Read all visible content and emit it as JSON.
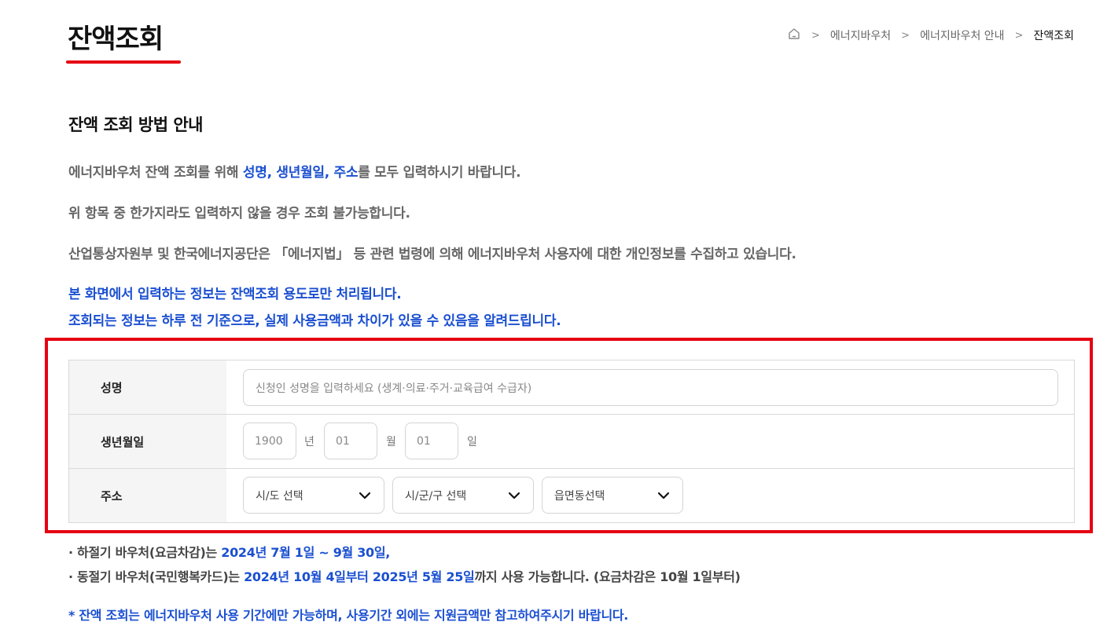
{
  "header": {
    "title": "잔액조회",
    "breadcrumb": [
      "에너지바우처",
      "에너지바우처 안내",
      "잔액조회"
    ]
  },
  "guide": {
    "heading": "잔액 조회 방법 안내",
    "line1_pre": "에너지바우처 잔액 조회를 위해 ",
    "line1_highlight": "성명, 생년월일, 주소",
    "line1_post": "를 모두 입력하시기 바랍니다.",
    "line2": "위 항목 중 한가지라도 입력하지 않을 경우 조회 불가능합니다.",
    "line3": "산업통상자원부 및 한국에너지공단은 「에너지법」 등 관련 법령에 의해 에너지바우처 사용자에 대한 개인정보를 수집하고 있습니다.",
    "notice1": "본 화면에서 입력하는 정보는 잔액조회 용도로만 처리됩니다.",
    "notice2": "조회되는 정보는 하루 전 기준으로, 실제 사용금액과 차이가 있을 수 있음을 알려드립니다."
  },
  "form": {
    "name_label": "성명",
    "name_placeholder": "신청인 성명을 입력하세요 (생계·의료·주거·교육급여 수급자)",
    "birth_label": "생년월일",
    "birth_year_placeholder": "1900",
    "birth_year_unit": "년",
    "birth_month_placeholder": "01",
    "birth_month_unit": "월",
    "birth_day_placeholder": "01",
    "birth_day_unit": "일",
    "address_label": "주소",
    "sido_select": "시/도 선택",
    "sigungu_select": "시/군/구 선택",
    "emd_select": "읍면동선택"
  },
  "notes": {
    "summer_pre": "· 하절기 바우처(요금차감)는 ",
    "summer_date": "2024년 7월 1일 ~ 9월 30일,",
    "winter_pre": "· 동절기 바우처(국민행복카드)는 ",
    "winter_date": "2024년 10월 4일부터 2025년 5월 25일",
    "winter_post": "까지 사용 가능합니다. (요금차감은 10월 1일부터)",
    "footer": "* 잔액 조회는 에너지바우처 사용 기간에만 가능하며, 사용기간 외에는 지원금액만 참고하여주시기 바랍니다."
  },
  "colors": {
    "accent_red": "#e60012",
    "highlight_blue": "#1a4fd1"
  },
  "icons": {
    "home": "home-icon",
    "separator": "chevron-right-icon",
    "dropdown": "chevron-down-icon"
  }
}
